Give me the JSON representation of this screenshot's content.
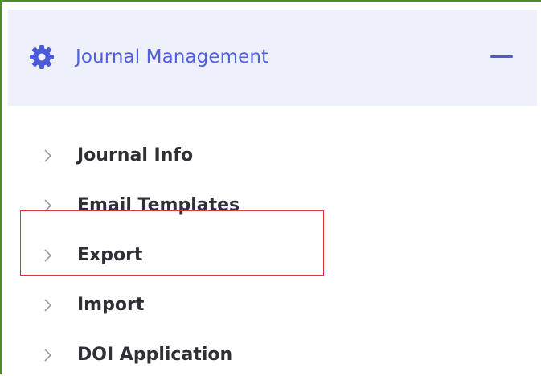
{
  "header": {
    "title": "Journal Management",
    "icon": "gear-icon",
    "collapse_icon": "minus-icon",
    "accent_color": "#5160e0"
  },
  "menu": {
    "items": [
      {
        "label": "Journal Info",
        "icon": "chevron-right-icon"
      },
      {
        "label": "Email Templates",
        "icon": "chevron-right-icon"
      },
      {
        "label": "Export",
        "icon": "chevron-right-icon",
        "highlighted": true
      },
      {
        "label": "Import",
        "icon": "chevron-right-icon"
      },
      {
        "label": "DOI Application",
        "icon": "chevron-right-icon"
      }
    ]
  },
  "highlight_color": "#d9363e"
}
